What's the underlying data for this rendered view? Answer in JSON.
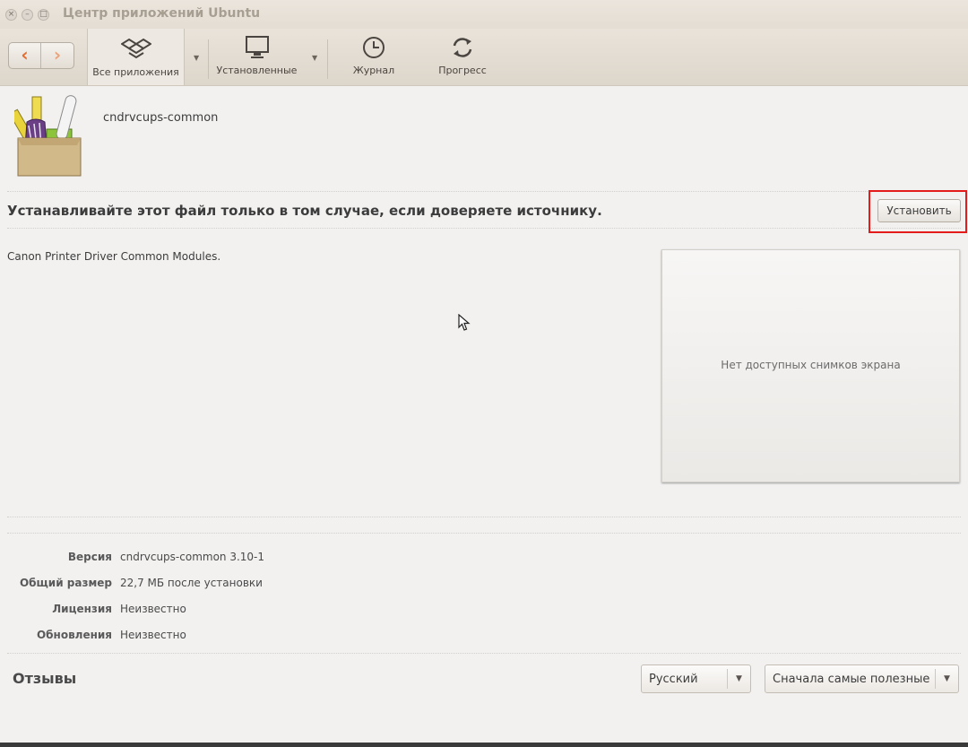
{
  "window": {
    "title": "Центр приложений Ubuntu",
    "close_glyph": "×",
    "minimize_glyph": "–",
    "maximize_glyph": "□"
  },
  "toolbar": {
    "back_glyph": "‹",
    "forward_glyph": "›",
    "items": [
      {
        "label": "Все приложения",
        "icon": "dropbox-box-icon"
      },
      {
        "label": "Установленные",
        "icon": "monitor-icon"
      },
      {
        "label": "Журнал",
        "icon": "clock-icon"
      },
      {
        "label": "Прогресс",
        "icon": "refresh-icon"
      }
    ]
  },
  "package": {
    "name": "cndrvcups-common",
    "warning": "Устанавливайте этот файл только в том случае, если доверяете источнику.",
    "install_label": "Установить",
    "description": "Canon Printer Driver Common Modules.",
    "no_screenshots": "Нет доступных снимков экрана"
  },
  "info": [
    {
      "key": "Версия",
      "value": "cndrvcups-common 3.10-1"
    },
    {
      "key": "Общий размер",
      "value": "22,7 МБ после установки"
    },
    {
      "key": "Лицензия",
      "value": "Неизвестно"
    },
    {
      "key": "Обновления",
      "value": "Неизвестно"
    }
  ],
  "reviews": {
    "title": "Отзывы",
    "language_selected": "Русский",
    "sort_selected": "Сначала самые полезные"
  },
  "colors": {
    "accent": "#e46b2e",
    "highlight_border": "#e31b1b"
  }
}
